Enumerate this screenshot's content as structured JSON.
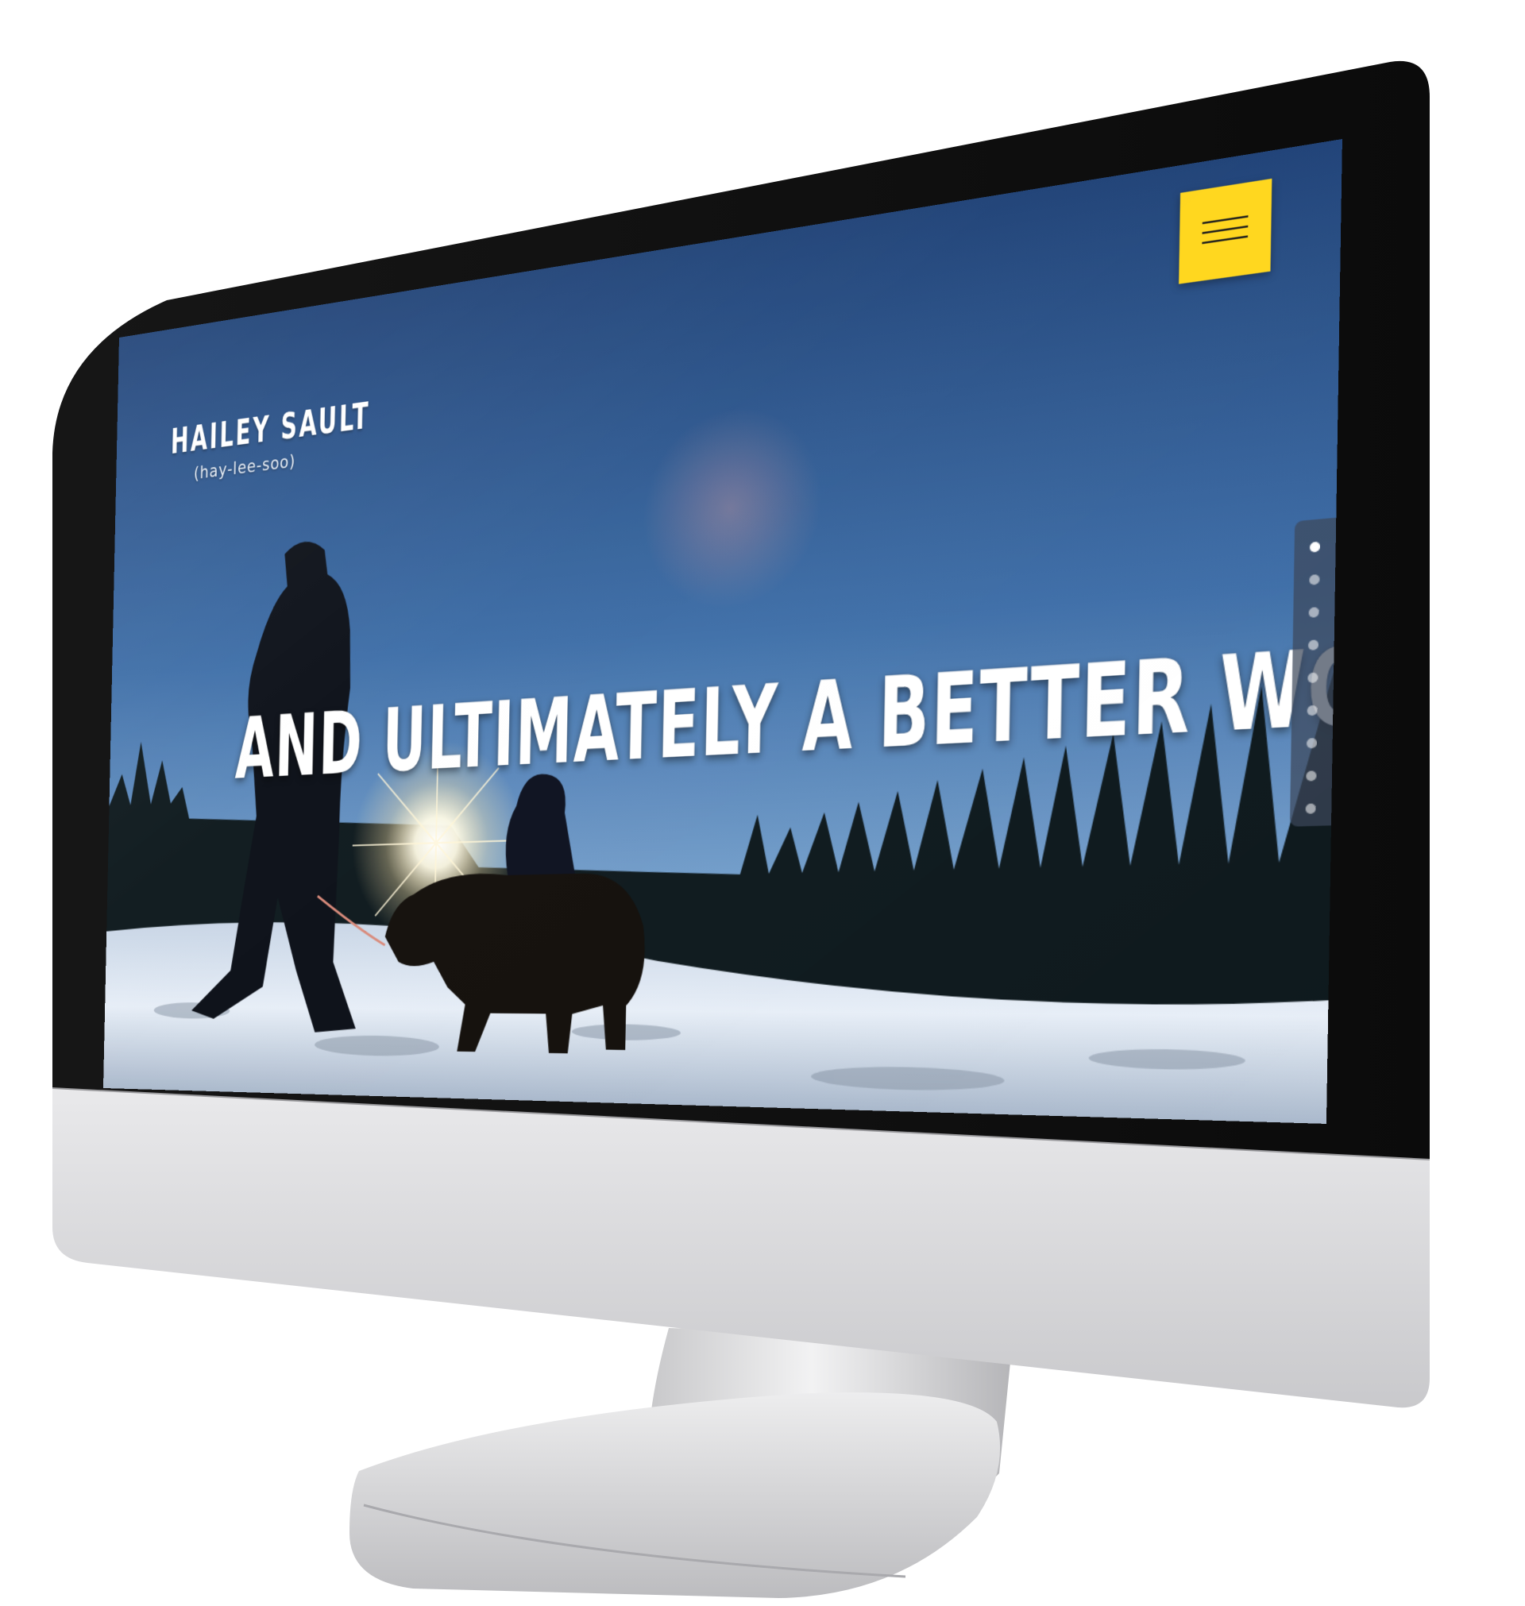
{
  "site": {
    "brand": {
      "name": "HAILEY SAULT",
      "pronunciation": "(hay-lee-soo)"
    },
    "hero": {
      "headline": "AND ULTIMATELY A BETTER WORLD",
      "scene": "person leading a child on a pony across snow, backlit by sun, forest behind"
    },
    "menu_button": {
      "icon": "hamburger-menu-icon",
      "color": "#ffd71c"
    },
    "section_nav": {
      "count": 9,
      "active_index": 0
    }
  },
  "device": {
    "type": "desktop monitor",
    "bezel_color": "#111111",
    "chin_color": "#d9d9db"
  }
}
